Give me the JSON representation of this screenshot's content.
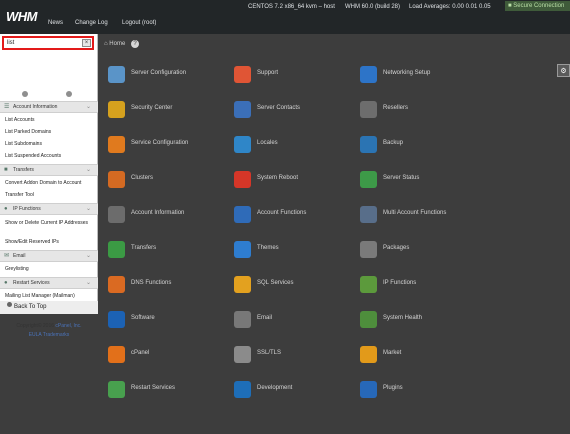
{
  "app": {
    "logo": "WHM"
  },
  "nav": {
    "items": [
      "News",
      "Change Log",
      "Logout (root)"
    ]
  },
  "status": {
    "os": "CENTOS 7.2 x86_64 kvm – host",
    "version": "WHM 60.0 (build 28)",
    "load": "Load Averages: 0.00 0.01 0.05",
    "secure": "Secure Connection"
  },
  "search": {
    "value": "list",
    "clear_glyph": "×"
  },
  "sidebar": {
    "categories": [
      {
        "label": "Account Information",
        "items": [
          "List Accounts",
          "List Parked Domains",
          "List Subdomains",
          "List Suspended Accounts"
        ]
      },
      {
        "label": "Transfers",
        "items": [
          "Convert Addon Domain to Account",
          "Transfer Tool"
        ]
      },
      {
        "label": "IP Functions",
        "items": [
          "Show or Delete Current IP Addresses",
          "Show/Edit Reserved IPs"
        ]
      },
      {
        "label": "Email",
        "items": [
          "Greylisting"
        ]
      },
      {
        "label": "Restart Services",
        "items": [
          "Mailing List Manager (Mailman)"
        ]
      }
    ],
    "back_to_top": "Back To Top",
    "copyright": "Copyright© 2016",
    "company": "cPanel, Inc.",
    "eula": "EULA",
    "trademarks": "Trademarks"
  },
  "main": {
    "breadcrumb": "Home",
    "help_glyph": "?",
    "tiles": [
      {
        "label": "Server Configuration",
        "color": "#5a94c8"
      },
      {
        "label": "Support",
        "color": "#e05535"
      },
      {
        "label": "Networking Setup",
        "color": "#2d74c8"
      },
      {
        "label": "Security Center",
        "color": "#d5a11e"
      },
      {
        "label": "Server Contacts",
        "color": "#3b6fb8"
      },
      {
        "label": "Resellers",
        "color": "#6d6d6d"
      },
      {
        "label": "Service Configuration",
        "color": "#e07a1e"
      },
      {
        "label": "Locales",
        "color": "#2f86c8"
      },
      {
        "label": "Backup",
        "color": "#2b74b3"
      },
      {
        "label": "Clusters",
        "color": "#d46a22"
      },
      {
        "label": "System Reboot",
        "color": "#d53628"
      },
      {
        "label": "Server Status",
        "color": "#3d9a48"
      },
      {
        "label": "Account Information",
        "color": "#6c6c6c"
      },
      {
        "label": "Account Functions",
        "color": "#2f6bb8"
      },
      {
        "label": "Multi Account Functions",
        "color": "#586e8a"
      },
      {
        "label": "Transfers",
        "color": "#3b9a44"
      },
      {
        "label": "Themes",
        "color": "#2e7dd0"
      },
      {
        "label": "Packages",
        "color": "#7a7a7a"
      },
      {
        "label": "DNS Functions",
        "color": "#da6a22"
      },
      {
        "label": "SQL Services",
        "color": "#e3a11f"
      },
      {
        "label": "IP Functions",
        "color": "#5c9a3c"
      },
      {
        "label": "Software",
        "color": "#1c62b4"
      },
      {
        "label": "Email",
        "color": "#787878"
      },
      {
        "label": "System Health",
        "color": "#4e8e3c"
      },
      {
        "label": "cPanel",
        "color": "#e2701a"
      },
      {
        "label": "SSL/TLS",
        "color": "#8b8b8b"
      },
      {
        "label": "Market",
        "color": "#e29a1a"
      },
      {
        "label": "Restart Services",
        "color": "#48a04e"
      },
      {
        "label": "Development",
        "color": "#1e6eb8"
      },
      {
        "label": "Plugins",
        "color": "#2768b8"
      }
    ]
  },
  "icons": {
    "search": "clear-icon",
    "home": "home-icon",
    "help": "help-icon",
    "settings": "gear-icon",
    "back": "back-to-top-icon"
  }
}
